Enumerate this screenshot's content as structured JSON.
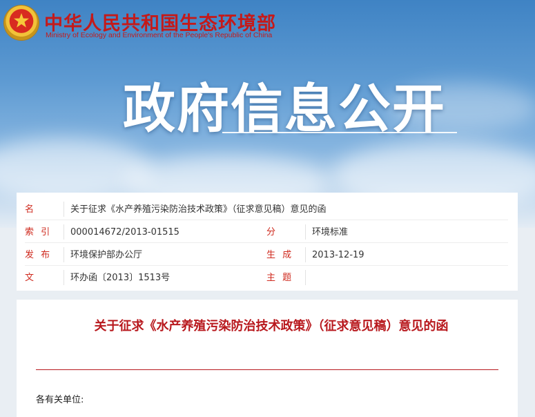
{
  "header": {
    "site_name_cn": "中华人民共和国生态环境部",
    "site_name_en": "Ministry of Ecology and Environment of the People's Republic of China",
    "banner_title": "政府信息公开",
    "emblem_icon": "national-emblem-icon"
  },
  "meta": {
    "rows": [
      {
        "label": "名　　称",
        "value": "关于征求《水产养殖污染防治技术政策》（征求意见稿）意见的函"
      },
      {
        "label": "索 引 号",
        "value": "000014672/2013-01515",
        "label2": "分　　类",
        "value2": "环境标准"
      },
      {
        "label": "发 布 机 关",
        "value": "环境保护部办公厅",
        "label2": "生 成 日 期",
        "value2": "2013-12-19"
      },
      {
        "label": "文　　号",
        "value": "环办函〔2013〕1513号",
        "label2": "主 题 词",
        "value2": ""
      }
    ]
  },
  "document": {
    "title": "关于征求《水产养殖污染防治技术政策》（征求意见稿）意见的函",
    "salutation": "各有关单位:"
  },
  "colors": {
    "accent_red": "#b8181d",
    "label_red": "#cf2a1e",
    "banner_blue": "#4a8ccb"
  }
}
